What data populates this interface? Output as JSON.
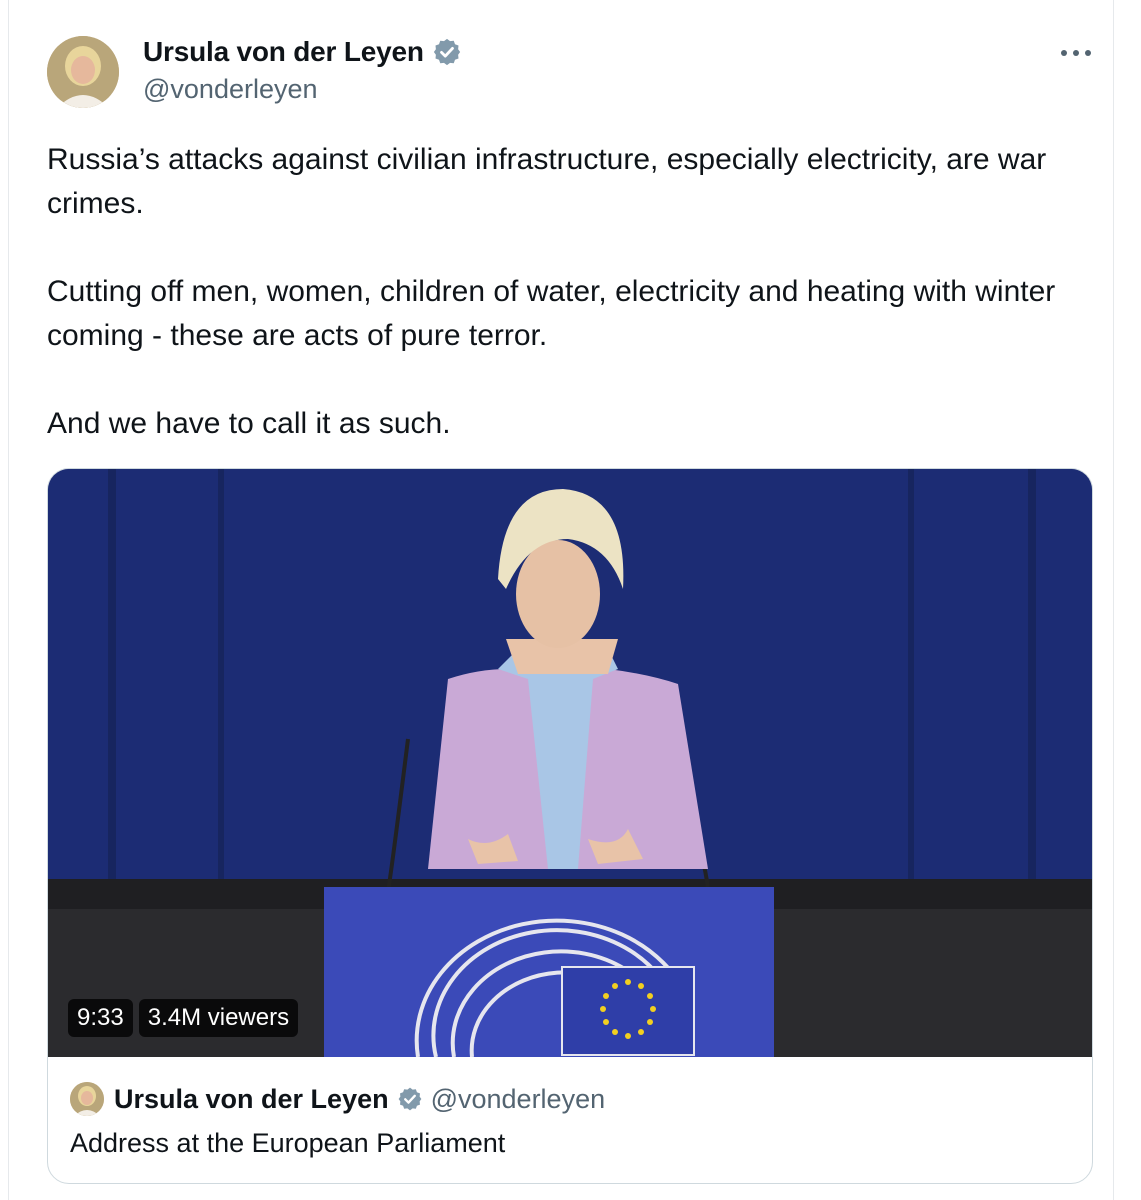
{
  "tweet": {
    "author_name": "Ursula von der Leyen",
    "author_handle": "@vonderleyen",
    "paragraphs": [
      "Russia’s attacks against civilian infrastructure, especially electricity, are war crimes.",
      "Cutting off men, women, children of water, electricity and heating with winter coming - these are acts of pure terror.",
      "And we have to call it as such."
    ]
  },
  "video": {
    "duration": "9:33",
    "viewers": "3.4M viewers"
  },
  "card": {
    "author_name": "Ursula von der Leyen",
    "author_handle": "@vonderleyen",
    "title": "Address at the European Parliament"
  },
  "colors": {
    "verified": "#829aab",
    "handle": "#536471",
    "backdrop": "#1a2a6e",
    "jacket": "#c9a9d6",
    "eu_flag": "#2f3ea8",
    "eu_stars": "#f2cf20"
  },
  "icons": {
    "verified": "verified-badge-icon",
    "more": "more-options-icon"
  }
}
